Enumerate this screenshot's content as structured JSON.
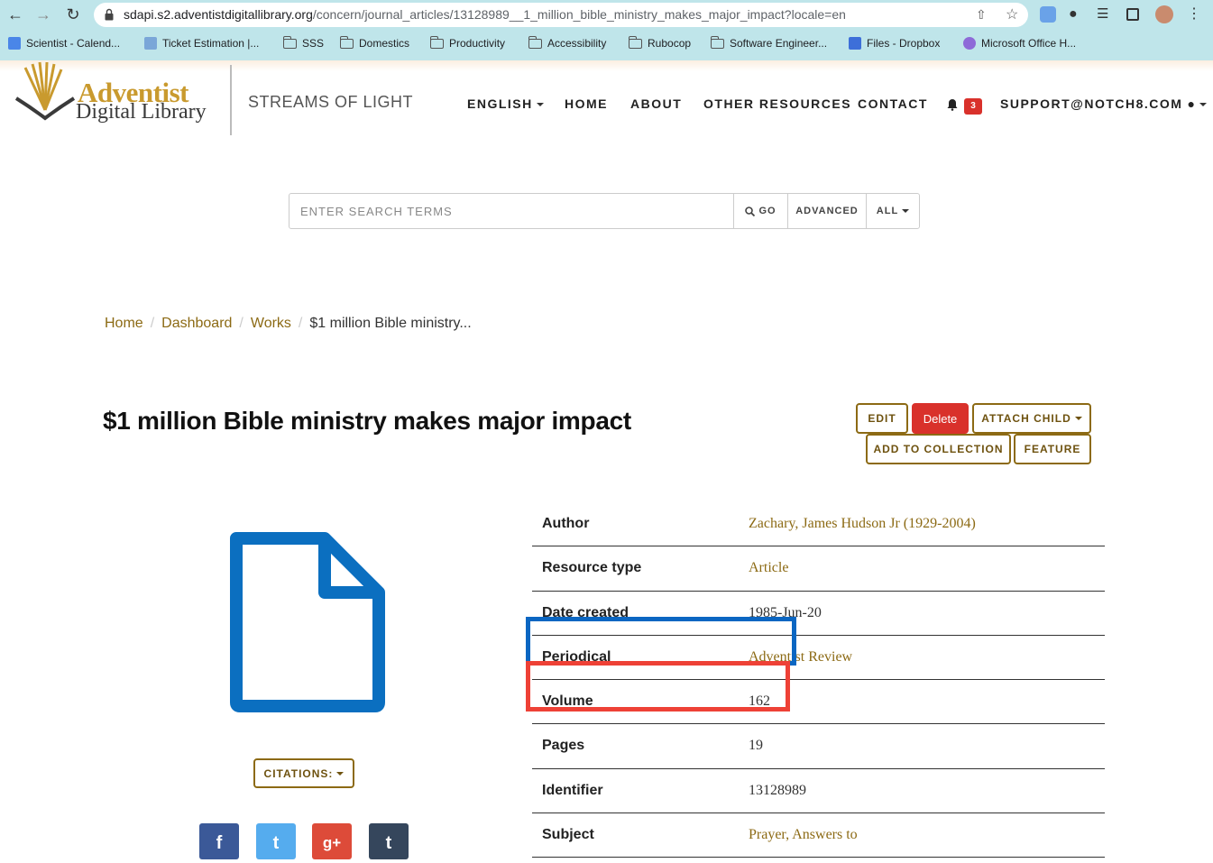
{
  "browser": {
    "url_host": "sdapi.s2.adventistdigitallibrary.org",
    "url_path": "/concern/journal_articles/13128989__1_million_bible_ministry_makes_major_impact?locale=en",
    "bookmarks": [
      {
        "label": "Scientist - Calend...",
        "icon": "calendar-icon"
      },
      {
        "label": "Ticket Estimation |...",
        "icon": "ticket-icon"
      },
      {
        "label": "SSS",
        "icon": "folder-icon"
      },
      {
        "label": "Domestics",
        "icon": "folder-icon"
      },
      {
        "label": "Productivity",
        "icon": "folder-icon"
      },
      {
        "label": "Accessibility",
        "icon": "folder-icon"
      },
      {
        "label": "Rubocop",
        "icon": "folder-icon"
      },
      {
        "label": "Software Engineer...",
        "icon": "folder-icon"
      },
      {
        "label": "Files - Dropbox",
        "icon": "dropbox-icon"
      },
      {
        "label": "Microsoft Office H...",
        "icon": "office-icon"
      }
    ]
  },
  "header": {
    "logo_line1": "Adventist",
    "logo_line2": "Digital Library",
    "tagline": "STREAMS OF LIGHT",
    "nav": {
      "language": "ENGLISH",
      "home": "HOME",
      "about": "ABOUT",
      "other_resources": "OTHER RESOURCES",
      "contact": "CONTACT",
      "notification_count": "3",
      "user": "SUPPORT@NOTCH8.COM"
    }
  },
  "search": {
    "placeholder": "ENTER SEARCH TERMS",
    "go_label": "GO",
    "advanced_label": "ADVANCED",
    "scope_label": "ALL"
  },
  "breadcrumb": [
    "Home",
    "Dashboard",
    "Works",
    "$1 million Bible ministry..."
  ],
  "work": {
    "title": "$1 million Bible ministry makes major impact",
    "actions": {
      "edit": "EDIT",
      "delete": "Delete",
      "attach_child": "ATTACH CHILD",
      "add_to_collection": "ADD TO COLLECTION",
      "feature": "FEATURE"
    },
    "citations_label": "CITATIONS:",
    "metadata": [
      {
        "key": "Author",
        "value": "Zachary, James Hudson Jr (1929-2004)",
        "link": true
      },
      {
        "key": "Resource type",
        "value": "Article",
        "link": true
      },
      {
        "key": "Date created",
        "value": "1985-Jun-20",
        "link": false
      },
      {
        "key": "Periodical",
        "value": "Adventist Review",
        "link": true
      },
      {
        "key": "Volume",
        "value": "162",
        "link": false
      },
      {
        "key": "Pages",
        "value": "19",
        "link": false
      },
      {
        "key": "Identifier",
        "value": "13128989",
        "link": false
      },
      {
        "key": "Subject",
        "value": "Prayer, Answers to",
        "link": true
      }
    ],
    "social": [
      "f",
      "t",
      "g+",
      "t"
    ]
  },
  "colors": {
    "brand_gold": "#8c6a14",
    "delete_red": "#d9312b",
    "highlight_blue": "#0b66c2",
    "highlight_red": "#ee4136",
    "file_icon_blue": "#0b6fc0"
  }
}
